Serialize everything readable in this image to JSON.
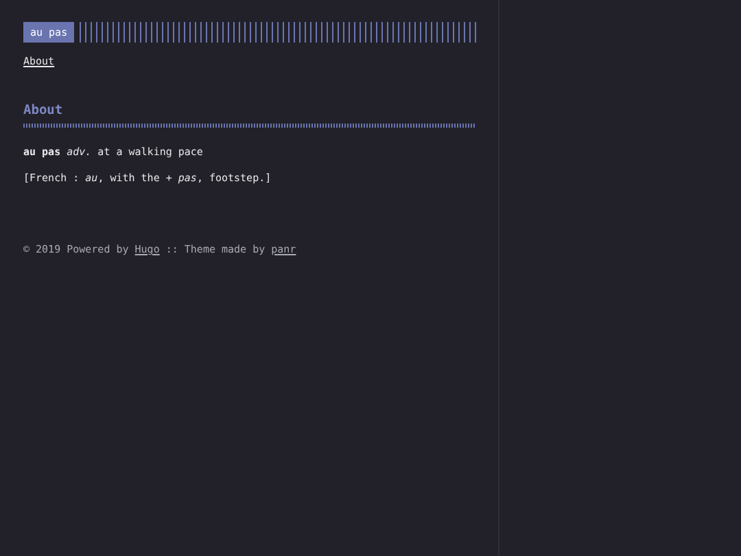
{
  "header": {
    "logo": "au pas",
    "menu": [
      {
        "label": "About"
      }
    ]
  },
  "post": {
    "title": "About",
    "paragraphs": [
      "**au pas** *adv.* at a walking pace",
      "[French : *au*, with the + *pas*, footstep.]"
    ]
  },
  "footer": {
    "parts": [
      {
        "kind": "text",
        "text": "© 2019 Powered by "
      },
      {
        "kind": "link",
        "text": "Hugo"
      },
      {
        "kind": "text",
        "text": " :: Theme made by "
      },
      {
        "kind": "link",
        "text": "panr"
      }
    ]
  }
}
